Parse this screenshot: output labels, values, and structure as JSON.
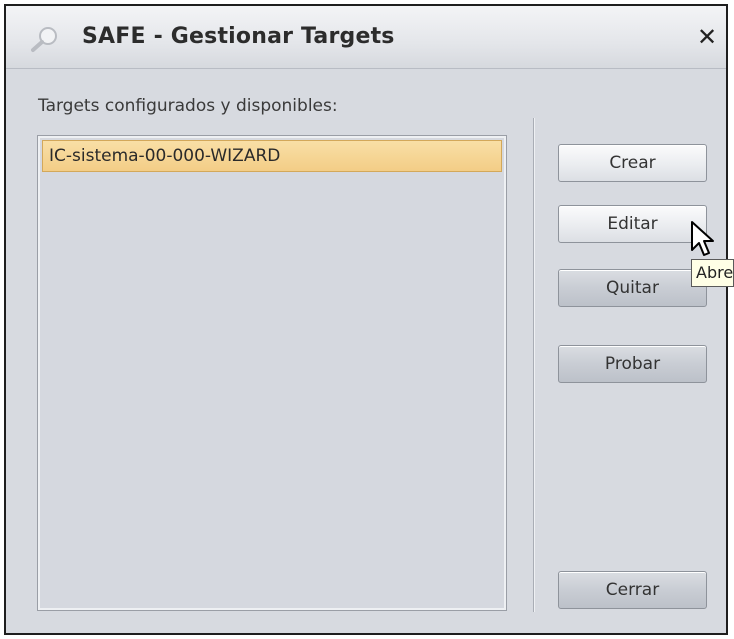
{
  "window": {
    "title": "SAFE - Gestionar Targets",
    "close_glyph": "✕"
  },
  "targets": {
    "label": "Targets configurados y disponibles:",
    "items": [
      {
        "label": "IC-sistema-00-000-WIZARD",
        "selected": true
      }
    ]
  },
  "buttons": {
    "crear": "Crear",
    "editar": "Editar",
    "quitar": "Quitar",
    "probar": "Probar",
    "cerrar": "Cerrar"
  },
  "tooltip": {
    "text": "Abre"
  },
  "icons": {
    "title": "magnifier-icon",
    "close": "close-icon",
    "cursor": "mouse-pointer-icon"
  },
  "colors": {
    "selection": "#f3cd86",
    "window_bg": "#d7dae0",
    "list_bg": "#d5d8df",
    "tooltip_bg": "#ffffe6"
  }
}
